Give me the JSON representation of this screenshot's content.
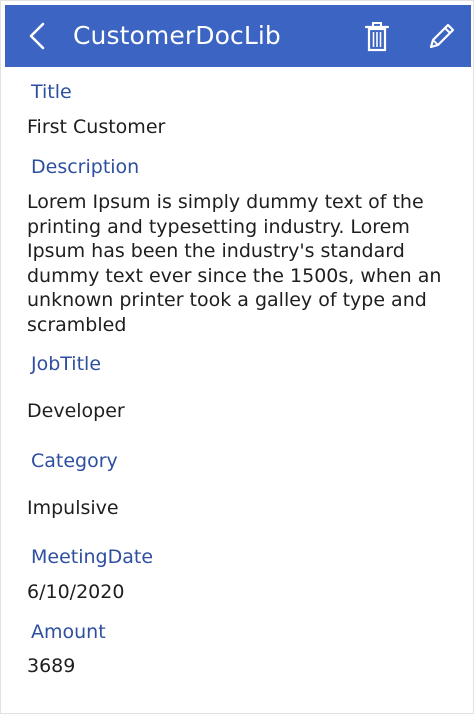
{
  "header": {
    "title": "CustomerDocLib",
    "background": "#3c64c2",
    "icons": [
      "back-icon",
      "trash-icon",
      "pencil-icon"
    ]
  },
  "fields": [
    {
      "label": "Title",
      "value": "First Customer"
    },
    {
      "label": "Description",
      "value": "Lorem Ipsum is simply dummy text of the printing and typesetting industry. Lorem Ipsum has been the industry's standard dummy text ever since the 1500s, when an unknown printer took a galley of type and scrambled"
    },
    {
      "label": "JobTitle",
      "value": "Developer"
    },
    {
      "label": "Category",
      "value": "Impulsive"
    },
    {
      "label": "MeetingDate",
      "value": "6/10/2020"
    },
    {
      "label": "Amount",
      "value": "3689"
    }
  ],
  "colors": {
    "label": "#2e4fa0",
    "value": "#1e1e1e"
  }
}
